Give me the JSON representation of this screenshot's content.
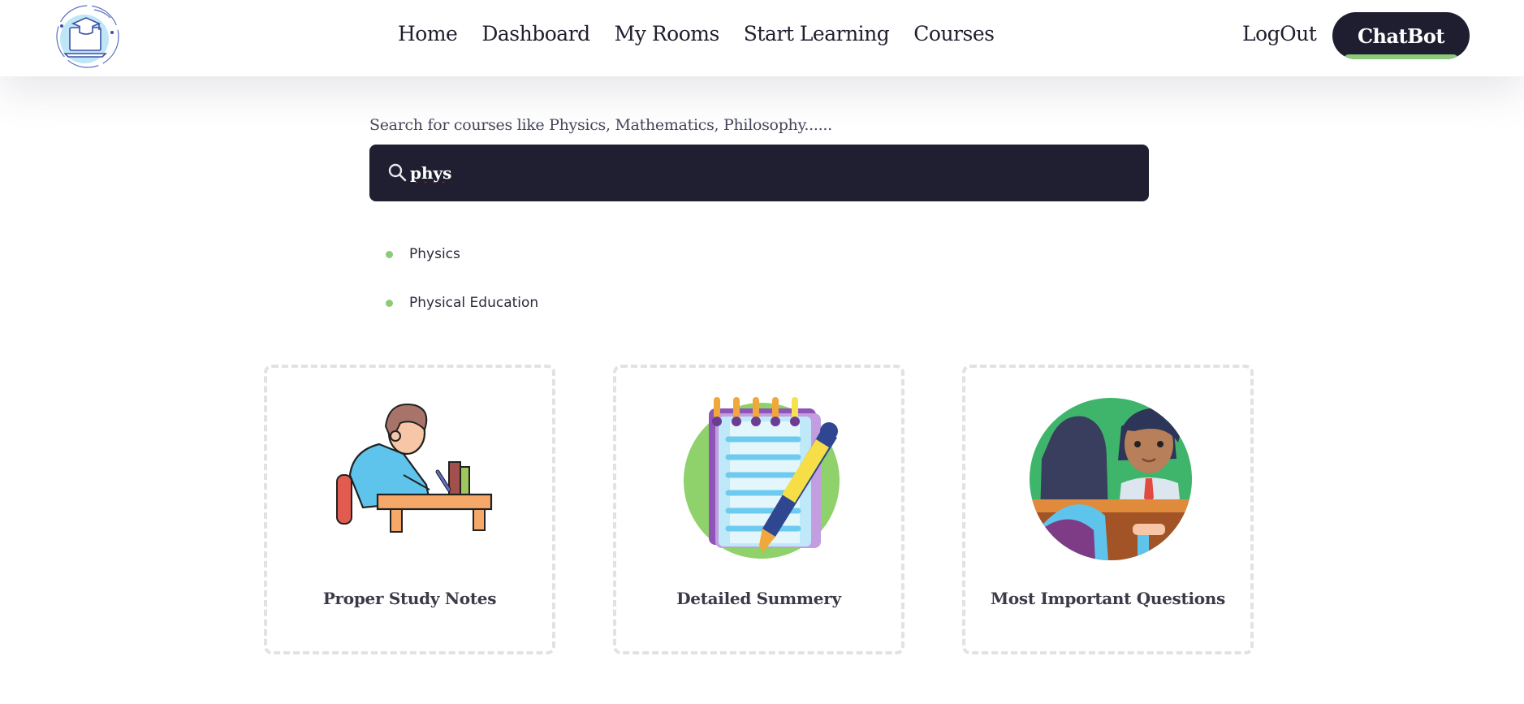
{
  "nav": {
    "links": [
      "Home",
      "Dashboard",
      "My Rooms",
      "Start Learning",
      "Courses"
    ],
    "logout": "LogOut",
    "chatbot": "ChatBot"
  },
  "search": {
    "hint": "Search for courses like Physics, Mathematics, Philosophy......",
    "value": "phys",
    "icon": "search-icon"
  },
  "suggestions": [
    "Physics",
    "Physical Education"
  ],
  "cards": [
    {
      "title": "Proper Study Notes",
      "icon": "student-studying-icon"
    },
    {
      "title": "Detailed Summery",
      "icon": "notebook-pen-icon"
    },
    {
      "title": "Most Important Questions",
      "icon": "teacher-student-icon"
    }
  ],
  "colors": {
    "dark": "#1f1e30",
    "accent": "#8cc97a",
    "card_border": "#e2e2e6"
  }
}
